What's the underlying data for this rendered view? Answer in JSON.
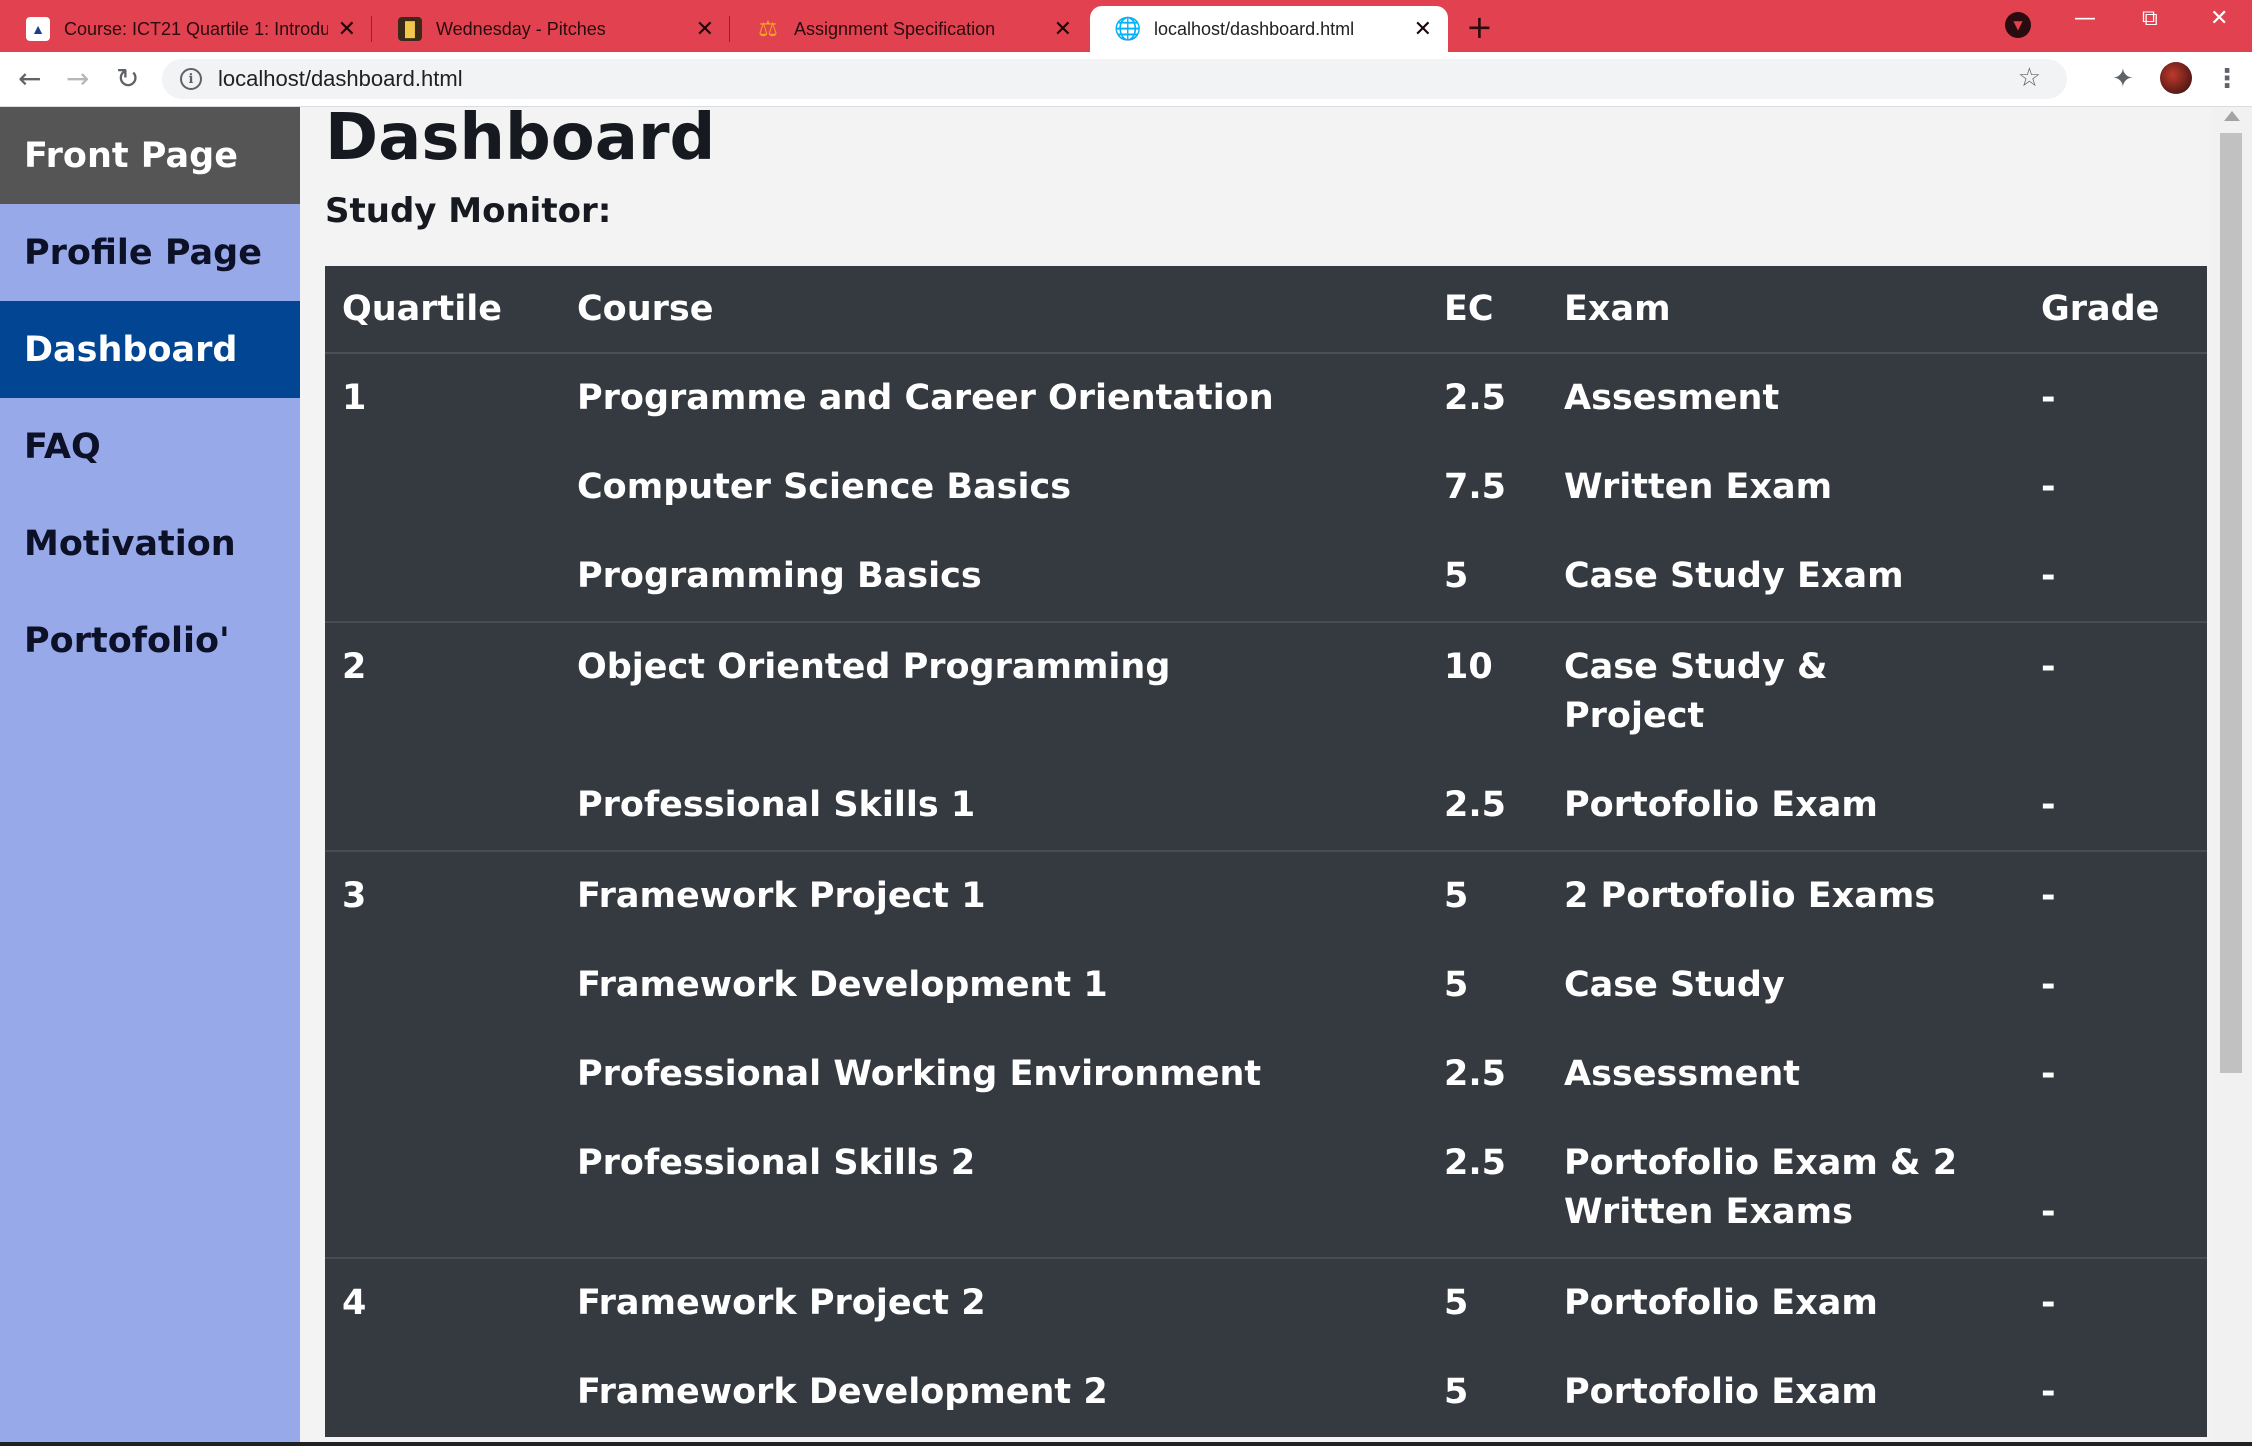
{
  "browser": {
    "tabs": [
      {
        "title": "Course: ICT21 Quartile 1: Introdu",
        "icon": "university-icon"
      },
      {
        "title": "Wednesday - Pitches",
        "icon": "clapperboard-icon"
      },
      {
        "title": "Assignment Specification",
        "icon": "scales-icon"
      },
      {
        "title": "localhost/dashboard.html",
        "icon": "globe-icon"
      }
    ],
    "url": "localhost/dashboard.html",
    "accent_color": "#e2414f"
  },
  "sidebar": {
    "items": [
      {
        "label": "Front Page"
      },
      {
        "label": "Profile Page"
      },
      {
        "label": "Dashboard"
      },
      {
        "label": "FAQ"
      },
      {
        "label": "Motivation"
      },
      {
        "label": "Portofolio'"
      }
    ],
    "active": "Dashboard",
    "background": "#98a9ea",
    "active_color": "#024592"
  },
  "main": {
    "title": "Dashboard",
    "subtitle": "Study Monitor:",
    "table": {
      "headers": [
        "Quartile",
        "Course",
        "EC",
        "Exam",
        "Grade"
      ],
      "rows": [
        {
          "quartile": "1",
          "course": "Programme and Career Orientation",
          "ec": "2.5",
          "exam": "Assesment",
          "grade": "-"
        },
        {
          "quartile": "",
          "course": "Computer Science Basics",
          "ec": "7.5",
          "exam": "Written Exam",
          "grade": "-"
        },
        {
          "quartile": "",
          "course": "Programming Basics",
          "ec": "5",
          "exam": "Case Study Exam",
          "grade": "-"
        },
        {
          "quartile": "2",
          "course": "Object Oriented Programming",
          "ec": "10",
          "exam": "Case Study & Project",
          "grade": "-"
        },
        {
          "quartile": "",
          "course": "Professional Skills 1",
          "ec": "2.5",
          "exam": "Portofolio Exam",
          "grade": "-"
        },
        {
          "quartile": "3",
          "course": "Framework Project 1",
          "ec": "5",
          "exam": "2 Portofolio Exams",
          "grade": "-"
        },
        {
          "quartile": "",
          "course": "Framework Development 1",
          "ec": "5",
          "exam": "Case Study",
          "grade": "-"
        },
        {
          "quartile": "",
          "course": "Professional Working Environment",
          "ec": "2.5",
          "exam": "Assessment",
          "grade": "-"
        },
        {
          "quartile": "",
          "course": "Professional Skills 2",
          "ec": "2.5",
          "exam": "Portofolio Exam & 2 Written Exams",
          "grade": "-"
        },
        {
          "quartile": "4",
          "course": "Framework Project 2",
          "ec": "5",
          "exam": "Portofolio Exam",
          "grade": "-"
        },
        {
          "quartile": "",
          "course": "Framework Development 2",
          "ec": "5",
          "exam": "Portofolio Exam",
          "grade": "-"
        }
      ]
    },
    "table_background": "#343a40"
  }
}
